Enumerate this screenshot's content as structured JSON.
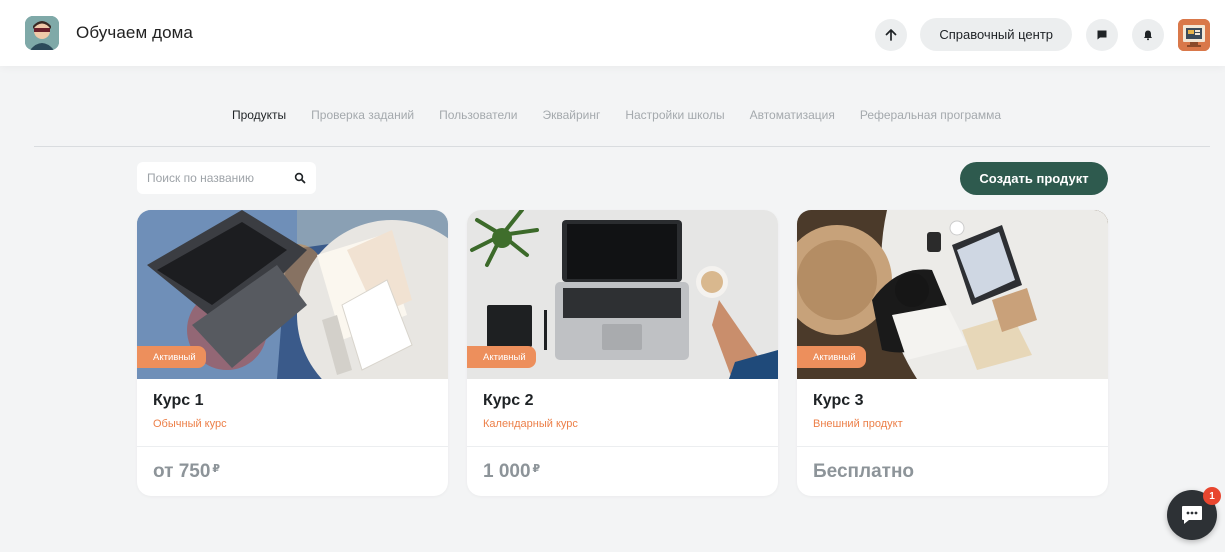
{
  "header": {
    "school_name": "Обучаем дома",
    "help_center_label": "Справочный центр",
    "icons": {
      "upload": "arrow-up-icon",
      "messages": "chat-square-icon",
      "notifications": "bell-icon"
    }
  },
  "tabs": [
    {
      "label": "Продукты",
      "active": true
    },
    {
      "label": "Проверка заданий",
      "active": false
    },
    {
      "label": "Пользователи",
      "active": false
    },
    {
      "label": "Эквайринг",
      "active": false
    },
    {
      "label": "Настройки школы",
      "active": false
    },
    {
      "label": "Автоматизация",
      "active": false
    },
    {
      "label": "Реферальная программа",
      "active": false
    }
  ],
  "search": {
    "placeholder": "Поиск по названию",
    "value": ""
  },
  "create_button_label": "Создать продукт",
  "cards": [
    {
      "status": "Активный",
      "title": "Курс 1",
      "type": "Обычный курс",
      "price": "от 750",
      "currency": "₽"
    },
    {
      "status": "Активный",
      "title": "Курс 2",
      "type": "Календарный курс",
      "price": "1 000",
      "currency": "₽"
    },
    {
      "status": "Активный",
      "title": "Курс 3",
      "type": "Внешний продукт",
      "price": "Бесплатно",
      "currency": ""
    }
  ],
  "chat_widget": {
    "unread_count": "1"
  },
  "colors": {
    "accent_green": "#2e5a4e",
    "badge_orange": "#ed8f5c",
    "course_type_orange": "#ec7f48",
    "price_gray": "#8d9499",
    "chat_badge_red": "#e8462f"
  }
}
